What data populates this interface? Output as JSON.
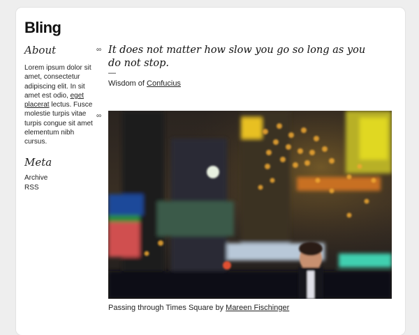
{
  "site": {
    "title": "Bling"
  },
  "sidebar": {
    "about_heading": "About",
    "about_text_before": "Lorem ipsum dolor sit amet, consectetur adipiscing elit. In sit amet est odio, ",
    "about_link": "eget placerat",
    "about_text_after": " lectus. Fusce molestie turpis vitae turpis congue sit amet elementum nibh cursus.",
    "meta_heading": "Meta",
    "meta_items": [
      "Archive",
      "RSS"
    ]
  },
  "posts": {
    "marker": "∞",
    "quote": {
      "text": "It does not matter how slow you go so long as you do not stop.",
      "dash": "—",
      "source_prefix": "Wisdom of ",
      "source_link": "Confucius"
    },
    "photo": {
      "caption_prefix": "Passing through Times Square by ",
      "caption_link": "Mareen Fischinger"
    }
  }
}
